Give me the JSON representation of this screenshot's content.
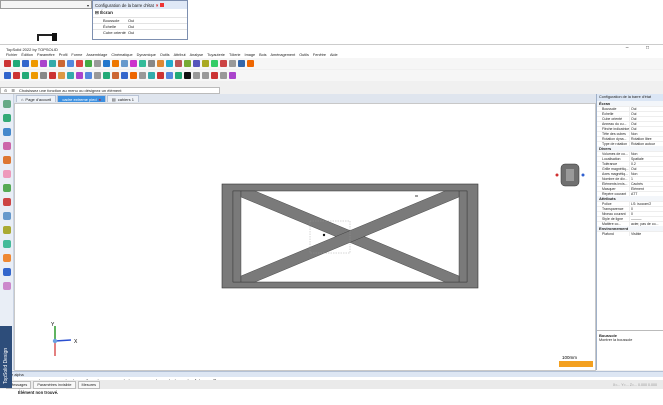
{
  "popup": {
    "title": "Configuration de la barre d'état",
    "section": "Écran",
    "rows": [
      {
        "key": "Boussole",
        "value": "Oui"
      },
      {
        "key": "Échelle",
        "value": "Oui"
      },
      {
        "key": "Cube orienté",
        "value": "Oui"
      }
    ]
  },
  "app": {
    "title": "TopSolid 2022 by TOPSOLID",
    "menu": [
      "Fichier",
      "Édition",
      "Paramètre",
      "Profil",
      "Forme",
      "Assemblage",
      "Cinématique",
      "Dynamique",
      "Outils",
      "Attribut",
      "Analyse",
      "Tuyauterie",
      "Tôlerie",
      "Image",
      "Bois",
      "Aménagement",
      "Outils",
      "Fenêtre",
      "Aide"
    ],
    "window_controls": "– □"
  },
  "command_bar": {
    "text": "Choisissez une fonction au menu ou désignez un élément"
  },
  "tabs": [
    {
      "label": "Page d'accueil",
      "active": false
    },
    {
      "label": "cadre extreme pied",
      "active": true
    },
    {
      "label": "cahiers 1",
      "active": false
    }
  ],
  "viewport": {
    "scale_label": "100mm",
    "axes": {
      "y": "Y",
      "x": "X"
    }
  },
  "right_panel": {
    "title": "Configuration de la barre d'état",
    "sections": [
      {
        "name": "Écran",
        "rows": [
          {
            "k": "Boussole",
            "v": "Oui"
          },
          {
            "k": "Échelle",
            "v": "Oui"
          },
          {
            "k": "Cube orienté",
            "v": "Oui"
          },
          {
            "k": "Anneau du cu...",
            "v": "Oui"
          },
          {
            "k": "Flèche indicatrice",
            "v": "Oui"
          },
          {
            "k": "Tête des cubes",
            "v": "Non"
          },
          {
            "k": "Rotation dyna...",
            "v": "Rotation libre"
          },
          {
            "k": "Type de rotation",
            "v": "Rotation autour"
          }
        ]
      },
      {
        "name": "Divers",
        "rows": [
          {
            "k": "Volumes de co...",
            "v": "Non"
          },
          {
            "k": "Localisation",
            "v": "Spatiale"
          },
          {
            "k": "Tolérance",
            "v": "0.2"
          },
          {
            "k": "Grille magnétiq...",
            "v": "Oui"
          },
          {
            "k": "Axes magnétiq...",
            "v": "Non"
          },
          {
            "k": "Nombre de div...",
            "v": "1"
          },
          {
            "k": "Éléments invis...",
            "v": "Cachés"
          },
          {
            "k": "Masquer",
            "v": "Élément"
          },
          {
            "k": "Repère courant",
            "v": "ATT"
          }
        ]
      },
      {
        "name": "Attributs",
        "rows": [
          {
            "k": "Police",
            "v": "LS: isocom/2"
          },
          {
            "k": "Transparence",
            "v": "0"
          },
          {
            "k": "Niveau courant",
            "v": "0"
          },
          {
            "k": "Style de ligne",
            "v": "———"
          },
          {
            "k": "Matière co...",
            "v": "acier, pas de co..."
          }
        ]
      },
      {
        "name": "Environnement",
        "rows": [
          {
            "k": "Plafond",
            "v": "Visible"
          }
        ]
      }
    ],
    "description": {
      "title": "Boussole",
      "text": "Montrer la boussole"
    }
  },
  "output": {
    "bar_label": "Barre alpha",
    "lines": [
      "Les contraintes sont redondantes [ : cadre extreme pied.top.@770.point projeté sur plan.[niveau-?]].",
      "Les contraintes sont redondantes [ : cadre extreme pied.top.@770.point projeté sur plan.[niveau-?]].",
      "Élément non trouvé."
    ],
    "tabs": [
      "Messages",
      "Paramètres invisible",
      "Mesures"
    ],
    "status_blur": "X=... Y=... Z=... 0.000 0.000"
  },
  "brand": "TopSolid Design",
  "colors": {
    "accent": "#3b8fe0",
    "frame": "#767676",
    "panel": "#dbe6f5"
  }
}
